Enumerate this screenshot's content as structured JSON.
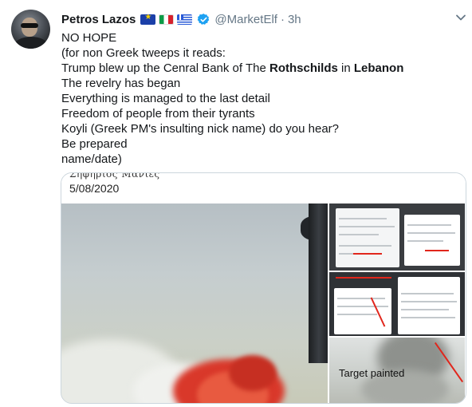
{
  "tweet": {
    "author_name": "Petros Lazos",
    "flags": [
      "eu-flag-icon",
      "italy-flag-icon",
      "greece-flag-icon"
    ],
    "handle": "@MarketElf",
    "separator": "·",
    "time": "3h",
    "lines": [
      "NO HOPE",
      "(for non Greek tweeps it reads:",
      "Trump blew up the Cenral Bank of The",
      "Rothschilds",
      "in",
      "Lebanon",
      "The revelry has began",
      "Everything is managed to the last detail",
      "Freedom of people from their tyrants",
      "Koyli (Greek PM's insulting nick name) do you hear?",
      "Be prepared",
      "name/date)"
    ]
  },
  "card": {
    "signature": "Σηφηρίος Μανίες",
    "date": "5/08/2020",
    "target_label": "Target painted"
  },
  "colors": {
    "text": "#14171a",
    "secondary": "#657786",
    "verified": "#1da1f2",
    "border": "#ccd6dd",
    "explosion": "#e03a2a"
  }
}
